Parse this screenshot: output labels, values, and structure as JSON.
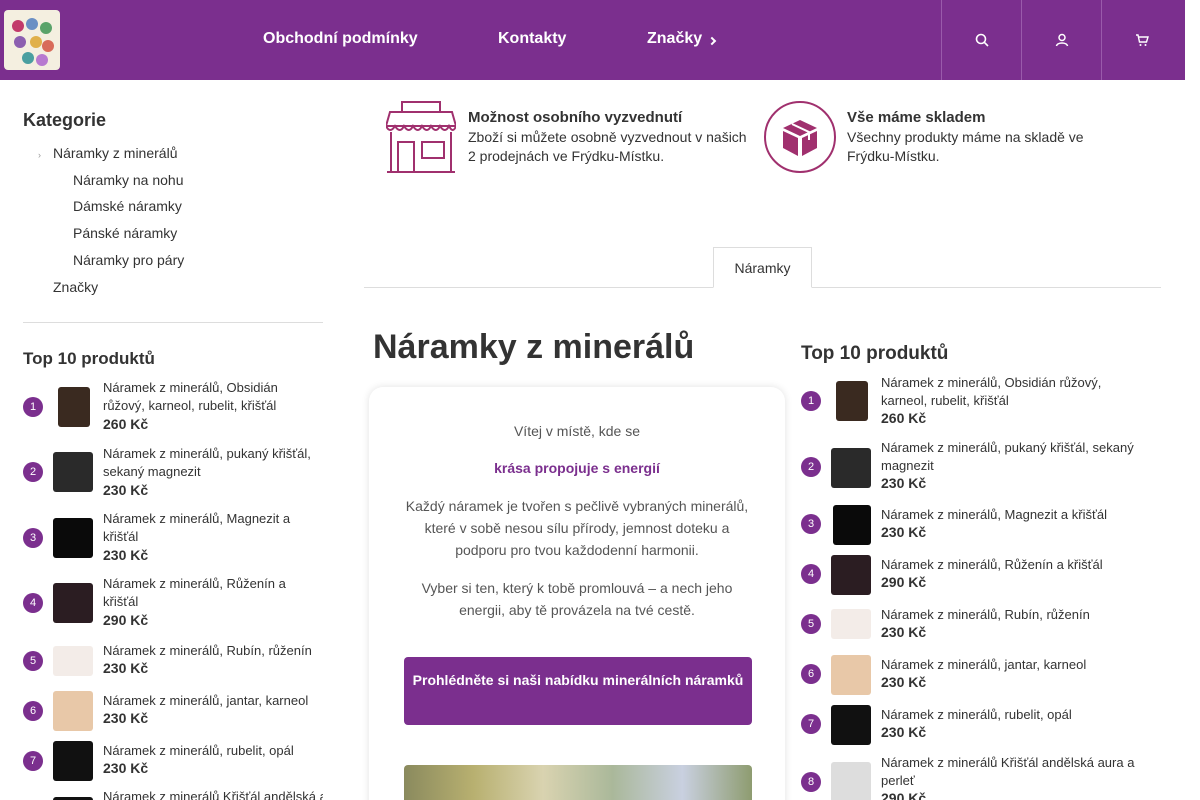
{
  "nav": {
    "items": [
      "Obchodní podmínky",
      "Kontakty",
      "Značky"
    ],
    "icons": [
      "search-icon",
      "user-icon",
      "cart-icon"
    ]
  },
  "sidebar": {
    "category_title": "Kategorie",
    "categories": [
      "Náramky z minerálů",
      "Náramky na nohu",
      "Dámské náramky",
      "Pánské náramky",
      "Náramky pro páry",
      "Značky"
    ],
    "top_title": "Top 10 produktů",
    "products": [
      {
        "n": "1",
        "name": "Náramek z minerálů, Obsidián růžový, karneol, rubelit, křišťál",
        "price": "260 Kč"
      },
      {
        "n": "2",
        "name": "Náramek z minerálů, pukaný křišťál, sekaný magnezit",
        "price": "230 Kč"
      },
      {
        "n": "3",
        "name": "Náramek z minerálů, Magnezit a křišťál",
        "price": "230 Kč"
      },
      {
        "n": "4",
        "name": "Náramek z minerálů, Růženín a křišťál",
        "price": "290 Kč"
      },
      {
        "n": "5",
        "name": "Náramek z minerálů, Rubín, růženín",
        "price": "230 Kč"
      },
      {
        "n": "6",
        "name": "Náramek z minerálů, jantar, karneol",
        "price": "230 Kč"
      },
      {
        "n": "7",
        "name": "Náramek z minerálů, rubelit, opál",
        "price": "230 Kč"
      },
      {
        "n": "8",
        "name": "Náramek z minerálů Křišťál andělská aura a perleť",
        "price": "290 Kč"
      }
    ]
  },
  "features": [
    {
      "title": "Možnost osobního vyzvednutí",
      "text": "Zboží si můžete osobně vyzvednout v našich 2 prodejnách ve Frýdku-Místku.",
      "icon": "store-icon"
    },
    {
      "title": "Vše máme skladem",
      "text": "Všechny produkty máme na skladě ve Frýdku-Místku.",
      "icon": "box-icon"
    }
  ],
  "tabs": [
    "Náramky"
  ],
  "main": {
    "title": "Náramky z minerálů",
    "intro1": "Vítej v místě, kde se",
    "intro_accent": "krása propojuje s energií",
    "intro2": "Každý náramek je tvořen s pečlivě vybraných minerálů, které v sobě nesou sílu přírody, jemnost doteku a podporu pro tvou každodenní harmonii.",
    "intro3": "Vyber si ten, který k tobě promlouvá – a nech jeho energii, aby tě provázela na tvé cestě.",
    "cta": "Prohlédněte si naši nabídku minerálních náramků"
  },
  "right": {
    "top_title": "Top 10 produktů"
  },
  "colors": {
    "brand": "#7b2f8e",
    "accent_icon": "#a0306e"
  }
}
